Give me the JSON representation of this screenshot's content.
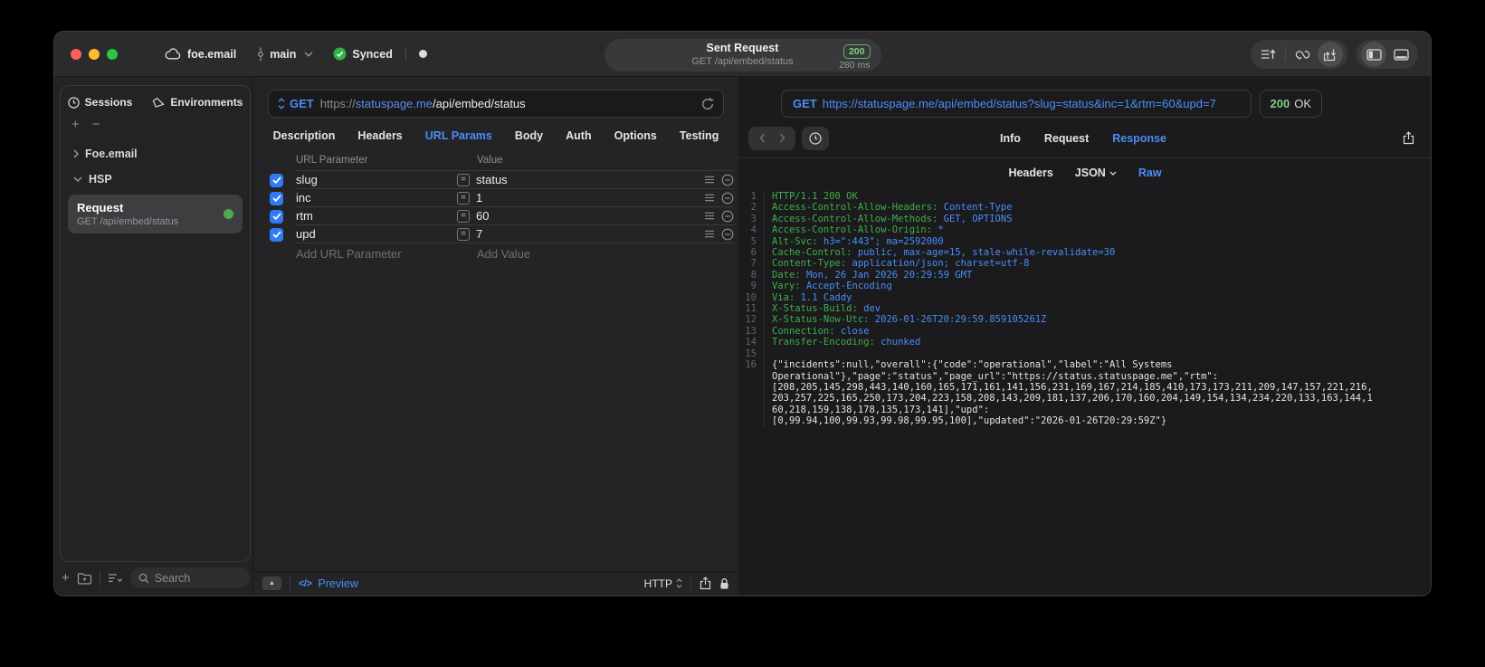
{
  "colors": {
    "accent_blue": "#4a8df8",
    "status_green": "#32d74b",
    "header_key_green": "#3fae4a",
    "header_value_blue": "#4a8df8"
  },
  "titlebar": {
    "project": "foe.email",
    "branch": "main",
    "synced_label": "Synced",
    "request_summary": {
      "title": "Sent Request",
      "subtitle": "GET /api/embed/status",
      "status_code": "200",
      "duration": "280 ms"
    }
  },
  "sidebar": {
    "tabs": [
      {
        "label": "Sessions"
      },
      {
        "label": "Environments"
      }
    ],
    "tree": [
      {
        "label": "Foe.email",
        "state": "collapsed"
      },
      {
        "label": "HSP",
        "state": "expanded"
      }
    ],
    "request_item": {
      "title": "Request",
      "subtitle": "GET /api/embed/status"
    },
    "search_placeholder": "Search"
  },
  "editor": {
    "method": "GET",
    "url_scheme": "https://",
    "url_host": "statuspage.me",
    "url_path": "/api/embed/status",
    "tabs": [
      {
        "label": "Description"
      },
      {
        "label": "Headers"
      },
      {
        "label": "URL Params",
        "active": true
      },
      {
        "label": "Body"
      },
      {
        "label": "Auth"
      },
      {
        "label": "Options"
      },
      {
        "label": "Testing"
      }
    ],
    "table": {
      "columns": [
        "URL Parameter",
        "Value"
      ],
      "rows": [
        {
          "name": "slug",
          "value": "status",
          "checked": true
        },
        {
          "name": "inc",
          "value": "1",
          "checked": true
        },
        {
          "name": "rtm",
          "value": "60",
          "checked": true
        },
        {
          "name": "upd",
          "value": "7",
          "checked": true
        }
      ],
      "add_name": "Add URL Parameter",
      "add_value": "Add Value"
    },
    "footer": {
      "code_glyph": "</>",
      "preview": "Preview",
      "protocol": "HTTP"
    }
  },
  "response": {
    "method": "GET",
    "url": "https://statuspage.me/api/embed/status?slug=status&inc=1&rtm=60&upd=7",
    "status_code": "200",
    "status_text": "OK",
    "tabs": [
      {
        "label": "Info"
      },
      {
        "label": "Request"
      },
      {
        "label": "Response",
        "active": true
      }
    ],
    "view_tabs": [
      {
        "label": "Headers"
      },
      {
        "label": "JSON",
        "has_dropdown": true
      },
      {
        "label": "Raw",
        "active": true
      }
    ],
    "code": {
      "lines": [
        {
          "n": "1",
          "segs": [
            [
              "g",
              "HTTP/1.1 200 OK"
            ]
          ]
        },
        {
          "n": "2",
          "segs": [
            [
              "g",
              "Access-Control-Allow-Headers: "
            ],
            [
              "b",
              "Content-Type"
            ]
          ]
        },
        {
          "n": "3",
          "segs": [
            [
              "g",
              "Access-Control-Allow-Methods: "
            ],
            [
              "b",
              "GET, OPTIONS"
            ]
          ]
        },
        {
          "n": "4",
          "segs": [
            [
              "g",
              "Access-Control-Allow-Origin: "
            ],
            [
              "b",
              "*"
            ]
          ]
        },
        {
          "n": "5",
          "segs": [
            [
              "g",
              "Alt-Svc: "
            ],
            [
              "b",
              "h3=\":443\"; ma=2592000"
            ]
          ]
        },
        {
          "n": "6",
          "segs": [
            [
              "g",
              "Cache-Control: "
            ],
            [
              "b",
              "public, max-age=15, stale-while-revalidate=30"
            ]
          ]
        },
        {
          "n": "7",
          "segs": [
            [
              "g",
              "Content-Type: "
            ],
            [
              "b",
              "application/json; charset=utf-8"
            ]
          ]
        },
        {
          "n": "8",
          "segs": [
            [
              "g",
              "Date: "
            ],
            [
              "b",
              "Mon, 26 Jan 2026 20:29:59 GMT"
            ]
          ]
        },
        {
          "n": "9",
          "segs": [
            [
              "g",
              "Vary: "
            ],
            [
              "b",
              "Accept-Encoding"
            ]
          ]
        },
        {
          "n": "10",
          "segs": [
            [
              "g",
              "Via: "
            ],
            [
              "b",
              "1.1 Caddy"
            ]
          ]
        },
        {
          "n": "11",
          "segs": [
            [
              "g",
              "X-Status-Build: "
            ],
            [
              "b",
              "dev"
            ]
          ]
        },
        {
          "n": "12",
          "segs": [
            [
              "g",
              "X-Status-Now-Utc: "
            ],
            [
              "b",
              "2026-01-26T20:29:59.859105261Z"
            ]
          ]
        },
        {
          "n": "13",
          "segs": [
            [
              "g",
              "Connection: "
            ],
            [
              "b",
              "close"
            ]
          ]
        },
        {
          "n": "14",
          "segs": [
            [
              "g",
              "Transfer-Encoding: "
            ],
            [
              "b",
              "chunked"
            ]
          ]
        },
        {
          "n": "15",
          "segs": []
        },
        {
          "n": "16",
          "segs": [
            [
              "w",
              "{\"incidents\":null,\"overall\":{\"code\":\"operational\",\"label\":\"All Systems\nOperational\"},\"page\":\"status\",\"page_url\":\"https://status.statuspage.me\",\"rtm\":\n[208,205,145,298,443,140,160,165,171,161,141,156,231,169,167,214,185,410,173,173,211,209,147,157,221,216,\n203,257,225,165,250,173,204,223,158,208,143,209,181,137,206,170,160,204,149,154,134,234,220,133,163,144,1\n60,218,159,138,178,135,173,141],\"upd\":\n[0,99.94,100,99.93,99.98,99.95,100],\"updated\":\"2026-01-26T20:29:59Z\"}"
            ]
          ]
        }
      ]
    }
  }
}
